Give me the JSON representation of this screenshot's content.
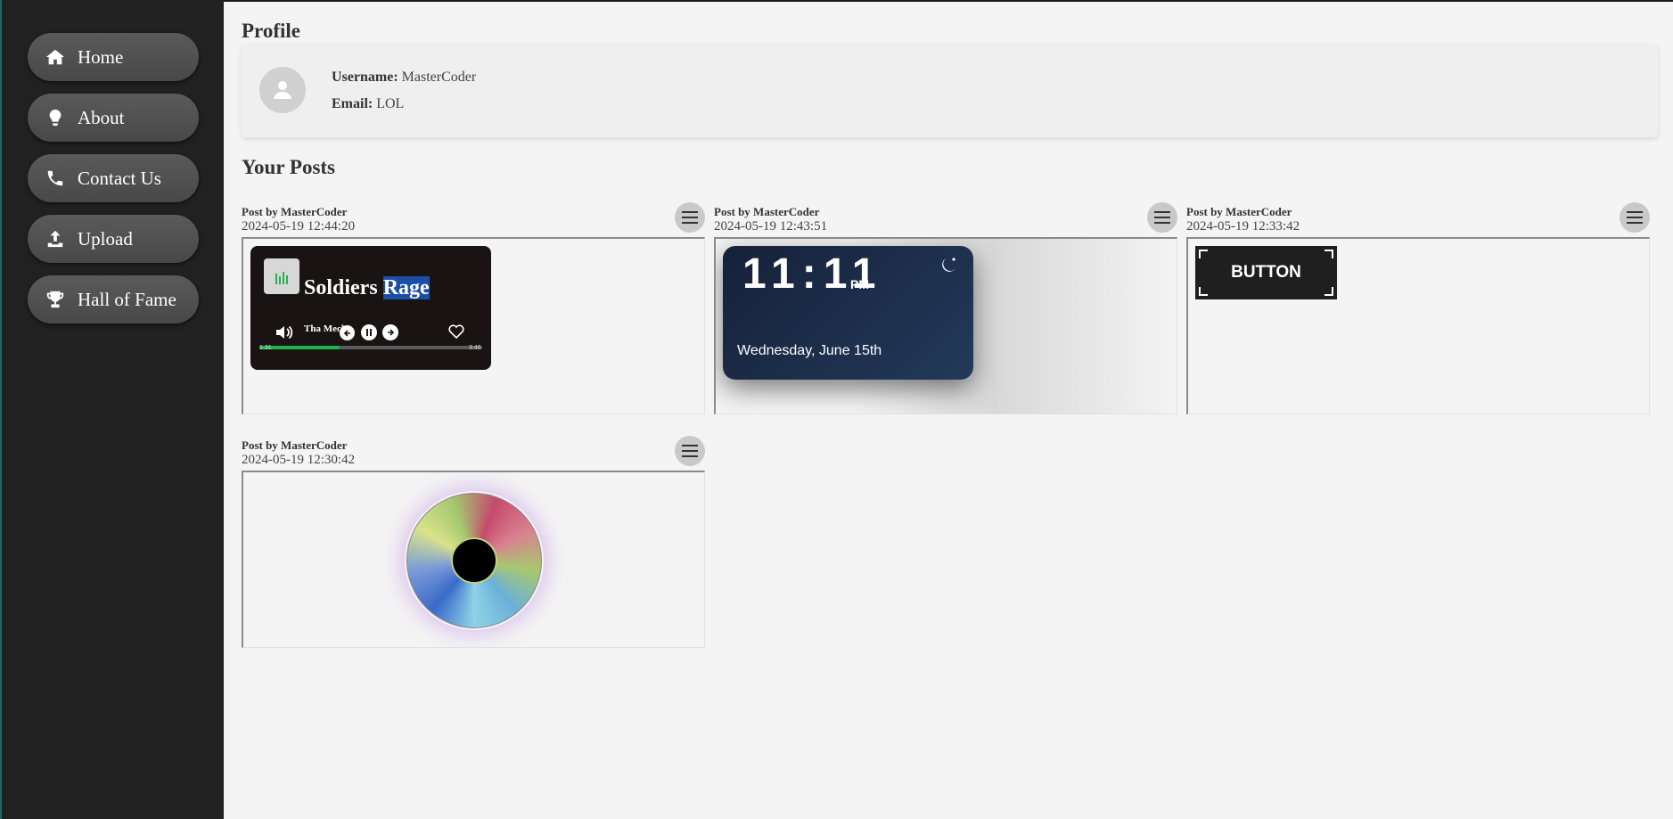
{
  "sidebar": {
    "items": [
      {
        "label": "Home",
        "icon": "home-icon"
      },
      {
        "label": "About",
        "icon": "lightbulb-icon"
      },
      {
        "label": "Contact Us",
        "icon": "phone-icon"
      },
      {
        "label": "Upload",
        "icon": "upload-icon"
      },
      {
        "label": "Hall of Fame",
        "icon": "trophy-icon"
      }
    ]
  },
  "profile": {
    "heading": "Profile",
    "username_label": "Username:",
    "username": "MasterCoder",
    "email_label": "Email:",
    "email": "LOL"
  },
  "posts_heading": "Your Posts",
  "posts": [
    {
      "by": "Post by MasterCoder",
      "date": "2024-05-19 12:44:20",
      "preview": {
        "type": "music-player",
        "song_part1": "Soldiers",
        "song_part2": "Rage",
        "artist": "Tha Mech",
        "time_elapsed": "1:31",
        "time_total": "3:46",
        "progress": 0.36
      }
    },
    {
      "by": "Post by MasterCoder",
      "date": "2024-05-19 12:43:51",
      "preview": {
        "type": "clock",
        "time": "11:11",
        "ampm": "PM",
        "date": "Wednesday, June 15th"
      }
    },
    {
      "by": "Post by MasterCoder",
      "date": "2024-05-19 12:33:42",
      "preview": {
        "type": "button",
        "label": "BUTTON"
      }
    },
    {
      "by": "Post by MasterCoder",
      "date": "2024-05-19 12:30:42",
      "preview": {
        "type": "ring"
      }
    }
  ],
  "colors": {
    "sidebar_bg": "#212121",
    "nav_item_bg": "#505050",
    "progress": "#22b14c",
    "highlight": "#1d4ea6",
    "clock_bg": "#1c2d49"
  }
}
